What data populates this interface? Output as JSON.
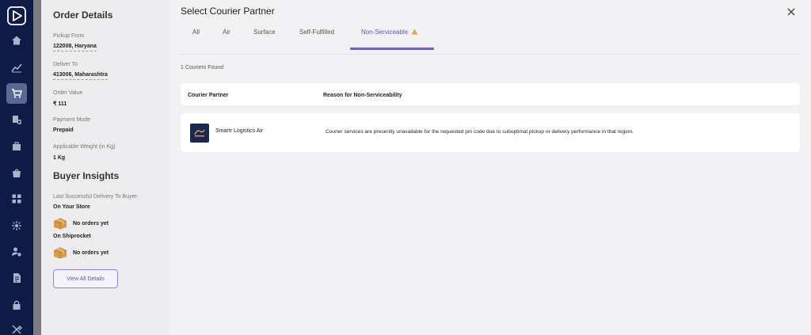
{
  "nav": {
    "items": [
      {
        "icon": "home-icon",
        "active": false
      },
      {
        "icon": "analytics-icon",
        "active": false
      },
      {
        "icon": "cart-icon",
        "active": true
      },
      {
        "icon": "returns-icon",
        "active": false
      },
      {
        "icon": "package-icon",
        "active": false
      },
      {
        "icon": "bag-icon",
        "active": false
      },
      {
        "icon": "grid-icon",
        "active": false
      },
      {
        "icon": "integrations-icon",
        "active": false
      },
      {
        "icon": "user-settings-icon",
        "active": false
      },
      {
        "icon": "document-icon",
        "active": false
      },
      {
        "icon": "lock-icon",
        "active": false
      },
      {
        "icon": "tools-icon",
        "active": false
      }
    ]
  },
  "details": {
    "title": "Order Details",
    "pickup_label": "Pickup From",
    "pickup_value": "122008, Haryana",
    "deliver_label": "Deliver To",
    "deliver_value": "413006, Maharashtra",
    "order_value_label": "Order Value",
    "order_value": "₹ 111",
    "payment_label": "Payment Mode",
    "payment_value": "Prepaid",
    "weight_label": "Applicable Weight (in Kg)",
    "weight_value": "1 Kg"
  },
  "insights": {
    "title": "Buyer Insights",
    "last_delivery_label": "Last Successful Delivery To Buyer:",
    "store_label": "On Your Store",
    "store_value": "No orders yet",
    "shiprocket_label": "On Shiprocket",
    "shiprocket_value": "No orders yet",
    "view_all_label": "View All Details"
  },
  "main": {
    "title": "Select Courier Partner",
    "tabs": [
      {
        "label": "All",
        "active": false
      },
      {
        "label": "Air",
        "active": false
      },
      {
        "label": "Surface",
        "active": false
      },
      {
        "label": "Self-Fulfilled",
        "active": false
      },
      {
        "label": "Non-Serviceable",
        "active": true
      }
    ],
    "found_text": "1 Couriers Found",
    "columns": [
      "Courier Partner",
      "Reason for Non-Serviceability"
    ],
    "rows": [
      {
        "partner": "Smartr Logistics Air",
        "reason": "Courier services are presently unavailable for the requested pin code due to suboptimal pickup or delivery performance in that region."
      }
    ]
  },
  "colors": {
    "nav_bg": "#0e1b46",
    "accent": "#6c5fd0",
    "warning": "#e8a33d"
  }
}
